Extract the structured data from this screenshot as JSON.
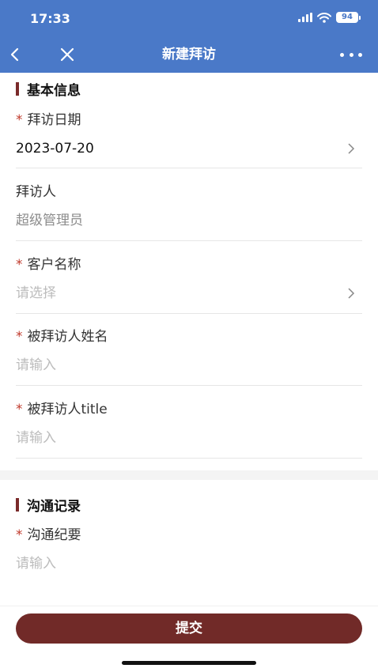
{
  "status_bar": {
    "time": "17:33",
    "battery": "94"
  },
  "nav": {
    "title": "新建拜访"
  },
  "section_basic": {
    "title": "基本信息"
  },
  "fields": {
    "visit_date": {
      "label": "拜访日期",
      "value": "2023-07-20"
    },
    "visitor": {
      "label": "拜访人",
      "value": "超级管理员"
    },
    "customer": {
      "label": "客户名称",
      "placeholder": "请选择"
    },
    "contact_name": {
      "label": "被拜访人姓名",
      "placeholder": "请输入"
    },
    "contact_title": {
      "label": "被拜访人title",
      "placeholder": "请输入"
    },
    "summary": {
      "label": "沟通纪要",
      "placeholder": "请输入"
    }
  },
  "section_comm": {
    "title": "沟通记录"
  },
  "required_mark": "*",
  "submit": {
    "label": "提交"
  },
  "colors": {
    "header": "#4a79c8",
    "accent": "#712a28",
    "required": "#c0392b"
  }
}
